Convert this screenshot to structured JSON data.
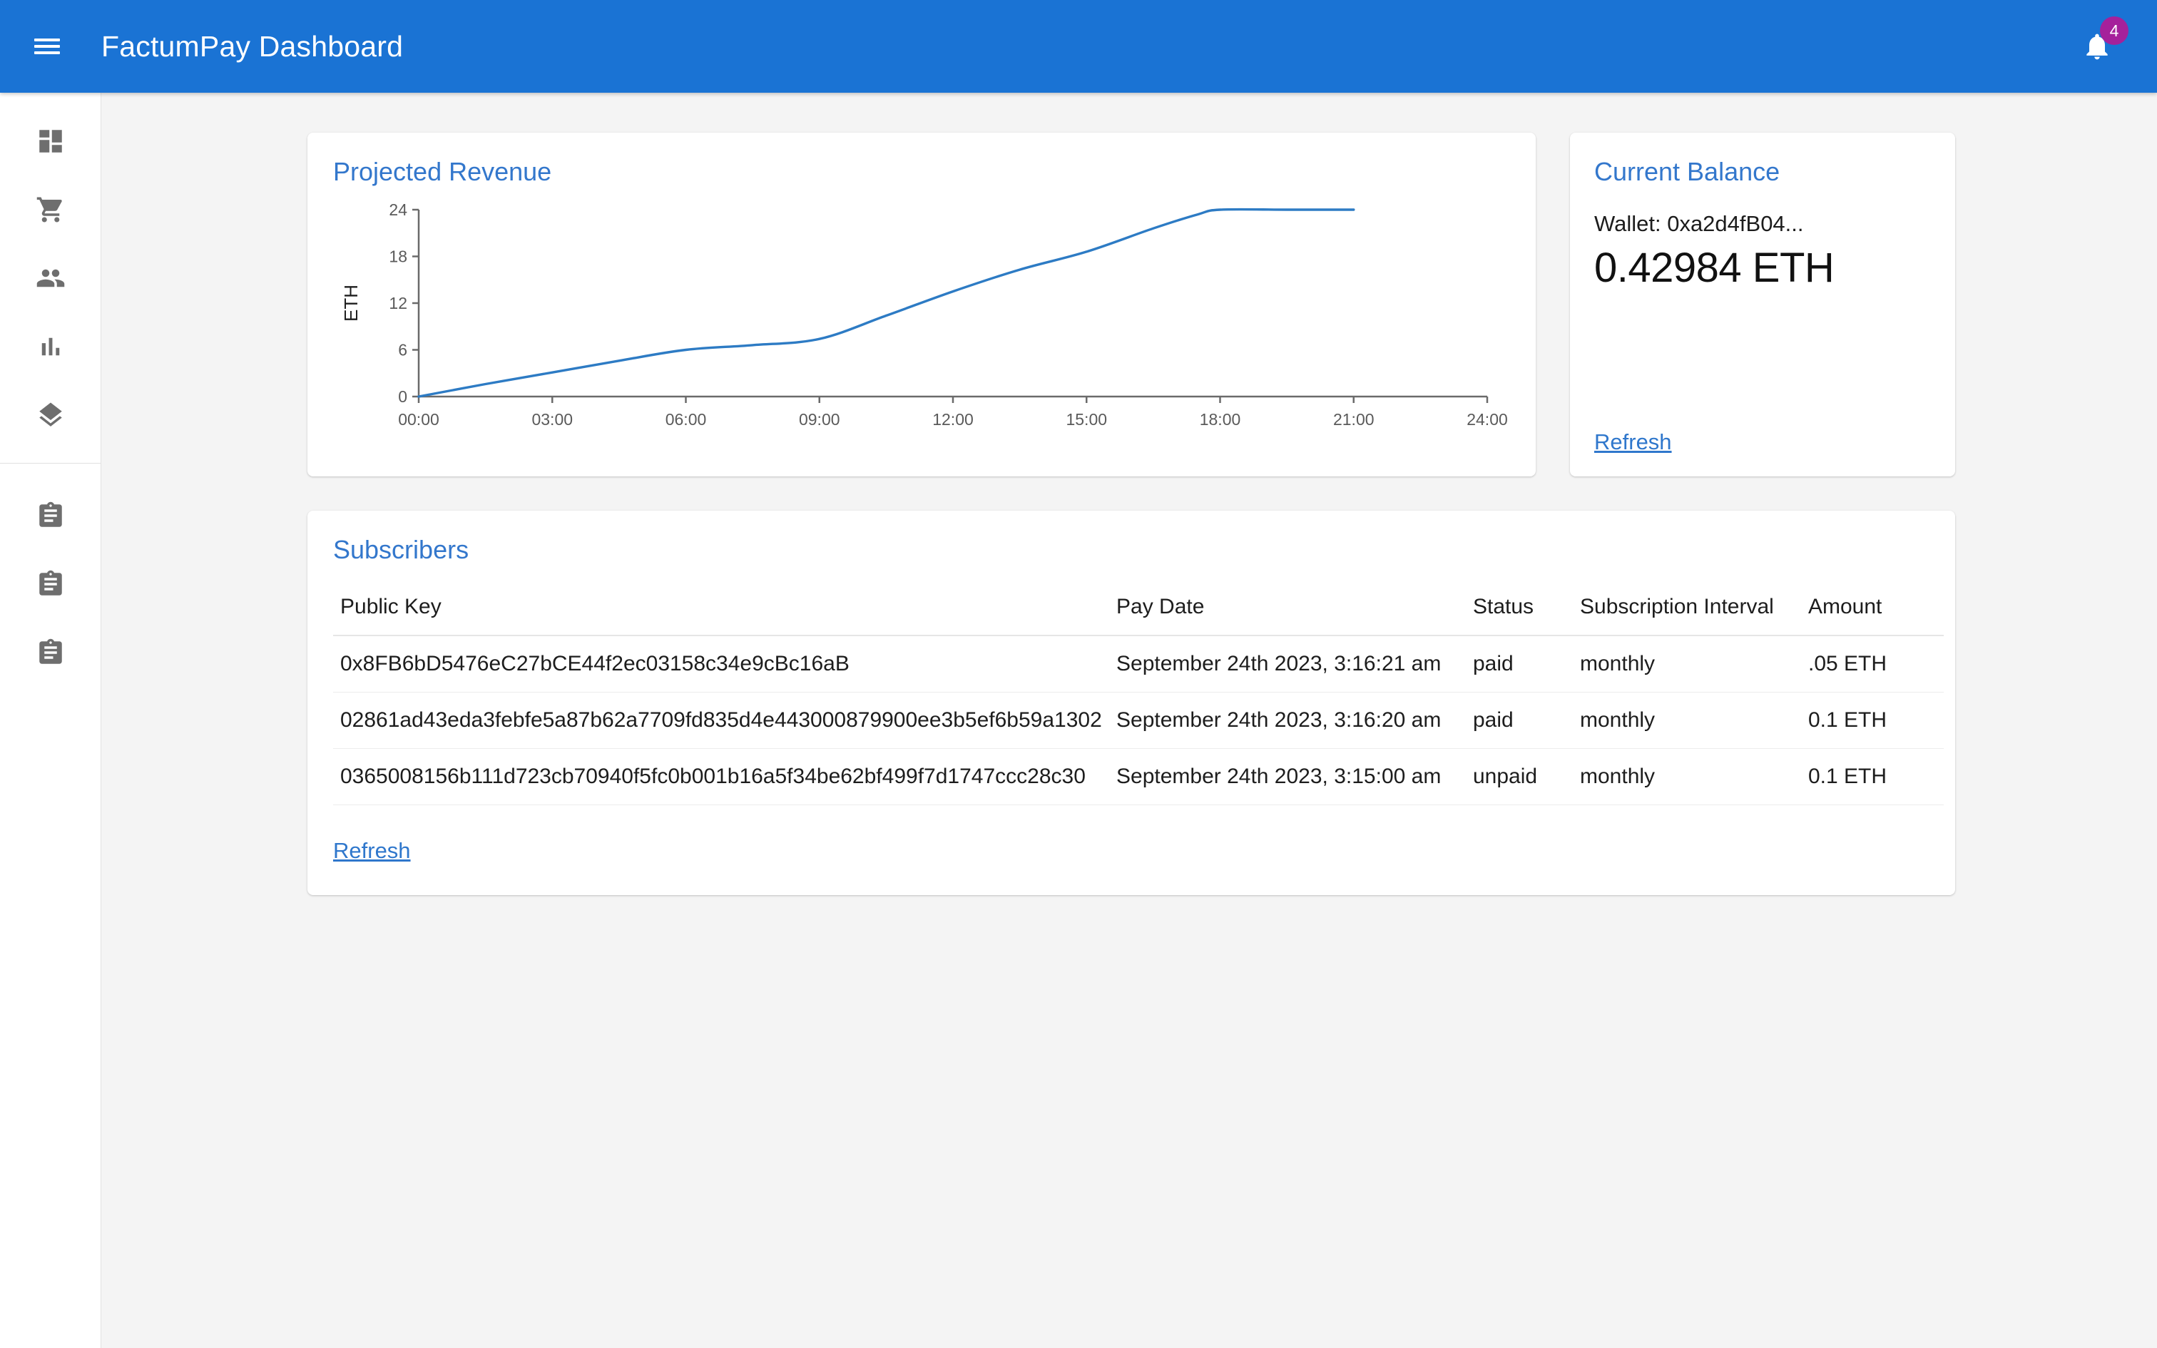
{
  "appbar": {
    "menu_icon": "hamburger-menu-icon",
    "title": "FactumPay Dashboard",
    "bell_icon": "notification-bell-icon",
    "badge_count": "4",
    "background_color": "#1a73d4",
    "badge_color": "#a5219b"
  },
  "sidebar": {
    "items": [
      {
        "icon": "dashboard-icon",
        "label": "Dashboard"
      },
      {
        "icon": "shopping-cart-icon",
        "label": "Orders"
      },
      {
        "icon": "people-icon",
        "label": "Customers"
      },
      {
        "icon": "bar-chart-icon",
        "label": "Reports"
      },
      {
        "icon": "layers-icon",
        "label": "Integrations"
      }
    ],
    "secondary_items": [
      {
        "icon": "clipboard-icon",
        "label": "Report 1"
      },
      {
        "icon": "clipboard-icon",
        "label": "Report 2"
      },
      {
        "icon": "clipboard-icon",
        "label": "Report 3"
      }
    ]
  },
  "revenue_card": {
    "title": "Projected Revenue"
  },
  "chart_data": {
    "type": "line",
    "title": "Projected Revenue",
    "xlabel": "",
    "ylabel": "ETH",
    "x_tick_labels": [
      "00:00",
      "03:00",
      "06:00",
      "09:00",
      "12:00",
      "15:00",
      "18:00",
      "21:00",
      "24:00"
    ],
    "y_tick_labels": [
      "0",
      "6",
      "12",
      "18",
      "24"
    ],
    "y_ticks": [
      0,
      6,
      12,
      18,
      24
    ],
    "ylim": [
      0,
      24
    ],
    "xlim": [
      0,
      24
    ],
    "grid": false,
    "legend": "none",
    "line_color": "#2d7bc4",
    "series": [
      {
        "name": "Projected Revenue",
        "x": [
          0,
          1.5,
          3,
          4.5,
          6,
          7.5,
          9,
          10.5,
          12,
          13.5,
          15,
          16.5,
          17.5,
          18,
          19.5,
          21
        ],
        "values": [
          0,
          1.6,
          3.1,
          4.6,
          6.0,
          6.6,
          7.4,
          10.4,
          13.5,
          16.3,
          18.6,
          21.6,
          23.4,
          24.0,
          24.0,
          24.0
        ]
      }
    ]
  },
  "balance_card": {
    "title": "Current Balance",
    "wallet_label": "Wallet: 0xa2d4fB04...",
    "amount": "0.42984 ETH",
    "refresh_label": "Refresh"
  },
  "subscribers_card": {
    "title": "Subscribers",
    "refresh_label": "Refresh",
    "columns": [
      "Public Key",
      "Pay Date",
      "Status",
      "Subscription Interval",
      "Amount"
    ],
    "rows": [
      {
        "public_key": "0x8FB6bD5476eC27bCE44f2ec03158c34e9cBc16aB",
        "pay_date": "September 24th 2023, 3:16:21 am",
        "status": "paid",
        "interval": "monthly",
        "amount": ".05 ETH"
      },
      {
        "public_key": "02861ad43eda3febfe5a87b62a7709fd835d4e443000879900ee3b5ef6b59a1302",
        "pay_date": "September 24th 2023, 3:16:20 am",
        "status": "paid",
        "interval": "monthly",
        "amount": "0.1 ETH"
      },
      {
        "public_key": "0365008156b111d723cb70940f5fc0b001b16a5f34be62bf499f7d1747ccc28c30",
        "pay_date": "September 24th 2023, 3:15:00 am",
        "status": "unpaid",
        "interval": "monthly",
        "amount": "0.1 ETH"
      }
    ]
  }
}
